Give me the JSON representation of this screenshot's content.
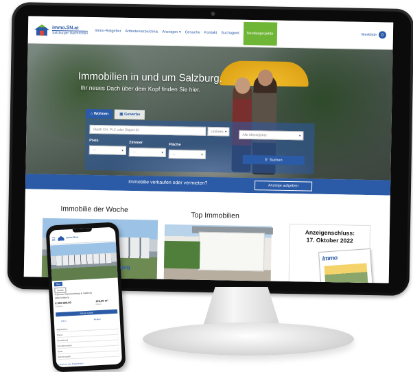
{
  "site": {
    "logo_name": "immo.SN.at",
    "logo_sub": "Salzburger Nachrichten",
    "nav": [
      "Immo-Ratgeber",
      "Anbieterverzeichnis",
      "Anzeigen",
      "Gesuche",
      "Kontakt",
      "Suchagent",
      "Neubauprojekte"
    ],
    "merkliste_label": "Merkliste",
    "merkliste_count": "0"
  },
  "hero": {
    "title": "Immobilien in und um Salzburg.",
    "subtitle": "Ihr neues Dach über dem Kopf finden Sie hier."
  },
  "search": {
    "tabs": [
      "Wohnen",
      "Gewerbe"
    ],
    "where_placeholder": "Stadt/ Ort, PLZ oder Objekt-ID",
    "radius": "Umkreis",
    "region": "Alle Mietobjekte",
    "preis_label": "Preis",
    "zimmer_label": "Zimmer",
    "flaeche_label": "Fläche",
    "dash": "---",
    "button": "Suchen"
  },
  "sellbar": {
    "text": "Immobilie verkaufen oder vermieten?",
    "button": "Anzeige aufgeben"
  },
  "sections": {
    "woche": "Immobilie der Woche",
    "top": "Top Immobilien"
  },
  "ad": {
    "line1": "Anzeigenschluss:",
    "line2": "17. Oktober 2022",
    "magazine_logo": "immo"
  },
  "phone": {
    "logo": "immo.SN.at\nSalzburger Nachrichten",
    "badge": "Neu",
    "back": "Zurück",
    "line1": "4-Zimmer Gartenwohnung in Salzburg",
    "line2": "5020 Salzburg",
    "price": "€ 520.000,00",
    "price_cap": "Kaufpreis",
    "area": "124,00 m²",
    "area_cap": "Fläche",
    "button": "Anfrage senden",
    "action1": "Teilen",
    "action2": "Merken",
    "accordion": [
      "Objektdaten",
      "Preise",
      "Ausstattung",
      "Energieausweis",
      "Karte",
      "Anbieterdaten"
    ],
    "footer": "Zurück zu den Ergebnissen",
    "side_text": "ung"
  }
}
